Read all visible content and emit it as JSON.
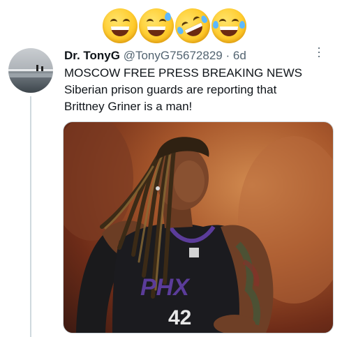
{
  "reactions": [
    "grinning-squinting-face-emoji",
    "grinning-face-with-sweat-emoji",
    "rolling-on-floor-laughing-emoji",
    "face-with-tears-of-joy-emoji"
  ],
  "tweet": {
    "display_name": "Dr. TonyG",
    "handle": "@TonyG75672829",
    "separator": " · ",
    "time": "6d",
    "more_glyph": "···",
    "lines": [
      "MOSCOW FREE PRESS BREAKING NEWS",
      "Siberian prison guards are reporting that",
      "Brittney Griner is a man!"
    ],
    "jersey_text": "PHX",
    "jersey_number": "42"
  },
  "colors": {
    "text_primary": "#0f1419",
    "text_secondary": "#536471",
    "thread_line": "#cfd9de",
    "jersey": "#1b1b1f",
    "phx_orange": "#e56020",
    "phx_purple": "#5b3c9a"
  }
}
